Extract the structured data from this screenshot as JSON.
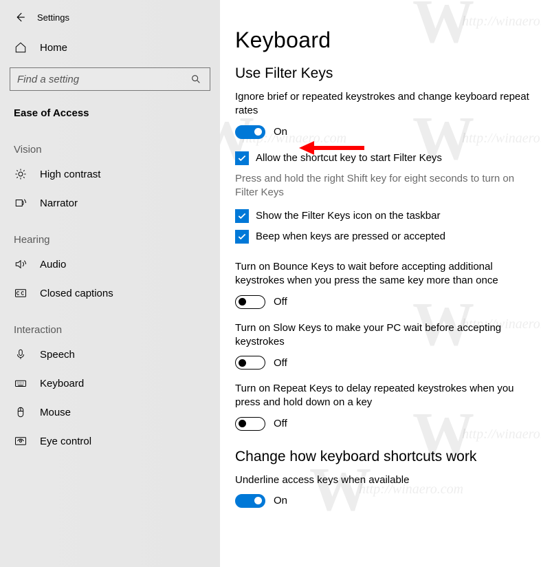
{
  "window": {
    "title": "Settings"
  },
  "sidebar": {
    "home": "Home",
    "search_placeholder": "Find a setting",
    "category": "Ease of Access",
    "groups": [
      {
        "label": "Vision",
        "items": [
          {
            "icon": "sun-icon",
            "label": "High contrast"
          },
          {
            "icon": "narrator-icon",
            "label": "Narrator"
          }
        ]
      },
      {
        "label": "Hearing",
        "items": [
          {
            "icon": "audio-icon",
            "label": "Audio"
          },
          {
            "icon": "cc-icon",
            "label": "Closed captions"
          }
        ]
      },
      {
        "label": "Interaction",
        "items": [
          {
            "icon": "mic-icon",
            "label": "Speech"
          },
          {
            "icon": "keyboard-icon",
            "label": "Keyboard"
          },
          {
            "icon": "mouse-icon",
            "label": "Mouse"
          },
          {
            "icon": "eye-icon",
            "label": "Eye control"
          }
        ]
      }
    ]
  },
  "main": {
    "h1": "Keyboard",
    "section_title": "Use Filter Keys",
    "filter_desc": "Ignore brief or repeated keystrokes and change keyboard repeat rates",
    "filter_toggle": {
      "state": "on",
      "label": "On"
    },
    "chk_shortcut": "Allow the shortcut key to start Filter Keys",
    "chk_shortcut_hint": "Press and hold the right Shift key for eight seconds to turn on Filter Keys",
    "chk_taskbar": "Show the Filter Keys icon on the taskbar",
    "chk_beep": "Beep when keys are pressed or accepted",
    "bounce_desc": "Turn on Bounce Keys to wait before accepting additional keystrokes when you press the same key more than once",
    "bounce_toggle": {
      "state": "off",
      "label": "Off"
    },
    "slow_desc": "Turn on Slow Keys to make your PC wait before accepting keystrokes",
    "slow_toggle": {
      "state": "off",
      "label": "Off"
    },
    "repeat_desc": "Turn on Repeat Keys to delay repeated keystrokes when you press and hold down on a key",
    "repeat_toggle": {
      "state": "off",
      "label": "Off"
    },
    "section2_title": "Change how keyboard shortcuts work",
    "underline_desc": "Underline access keys when available",
    "underline_toggle": {
      "state": "on",
      "label": "On"
    }
  },
  "watermark": {
    "letter": "W",
    "url": "http://winaero.com"
  }
}
